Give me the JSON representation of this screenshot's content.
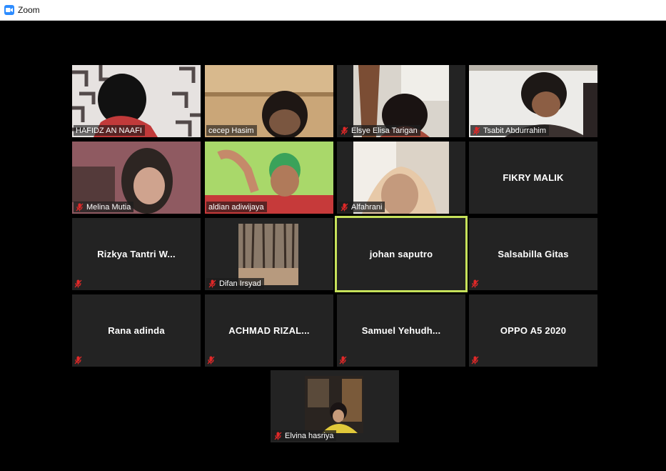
{
  "window": {
    "title": "Zoom",
    "icon": "zoom-app-icon"
  },
  "colors": {
    "tile_bg": "#232323",
    "active_border": "#c6e15a",
    "mute_red": "#e02828",
    "stage_bg": "#000000"
  },
  "participants": [
    {
      "name": "HAFIDZ AN NAAFI",
      "muted": false,
      "video": true
    },
    {
      "name": "cecep Hasim",
      "muted": false,
      "video": true
    },
    {
      "name": "Elsye Elisa Tarigan",
      "muted": true,
      "video": true
    },
    {
      "name": "Tsabit Abdurrahim",
      "muted": true,
      "video": true
    },
    {
      "name": "Melina Mutia",
      "muted": true,
      "video": true
    },
    {
      "name": "aldian adiwijaya",
      "muted": false,
      "video": true
    },
    {
      "name": "Alfahrani",
      "muted": true,
      "video": true
    },
    {
      "name": "FIKRY MALIK",
      "muted": false,
      "video": false
    },
    {
      "name": "Rizkya Tantri W...",
      "muted": true,
      "video": false
    },
    {
      "name": "Difan Irsyad",
      "muted": true,
      "video": true
    },
    {
      "name": "johan saputro",
      "muted": false,
      "video": false,
      "active_speaker": true
    },
    {
      "name": "Salsabilla Gitas",
      "muted": true,
      "video": false
    },
    {
      "name": "Rana adinda",
      "muted": true,
      "video": false
    },
    {
      "name": "ACHMAD RIZAL...",
      "muted": true,
      "video": false
    },
    {
      "name": "Samuel Yehudh...",
      "muted": true,
      "video": false
    },
    {
      "name": "OPPO A5 2020",
      "muted": true,
      "video": false
    },
    {
      "name": "Elvina hasriya",
      "muted": true,
      "video": true
    }
  ]
}
